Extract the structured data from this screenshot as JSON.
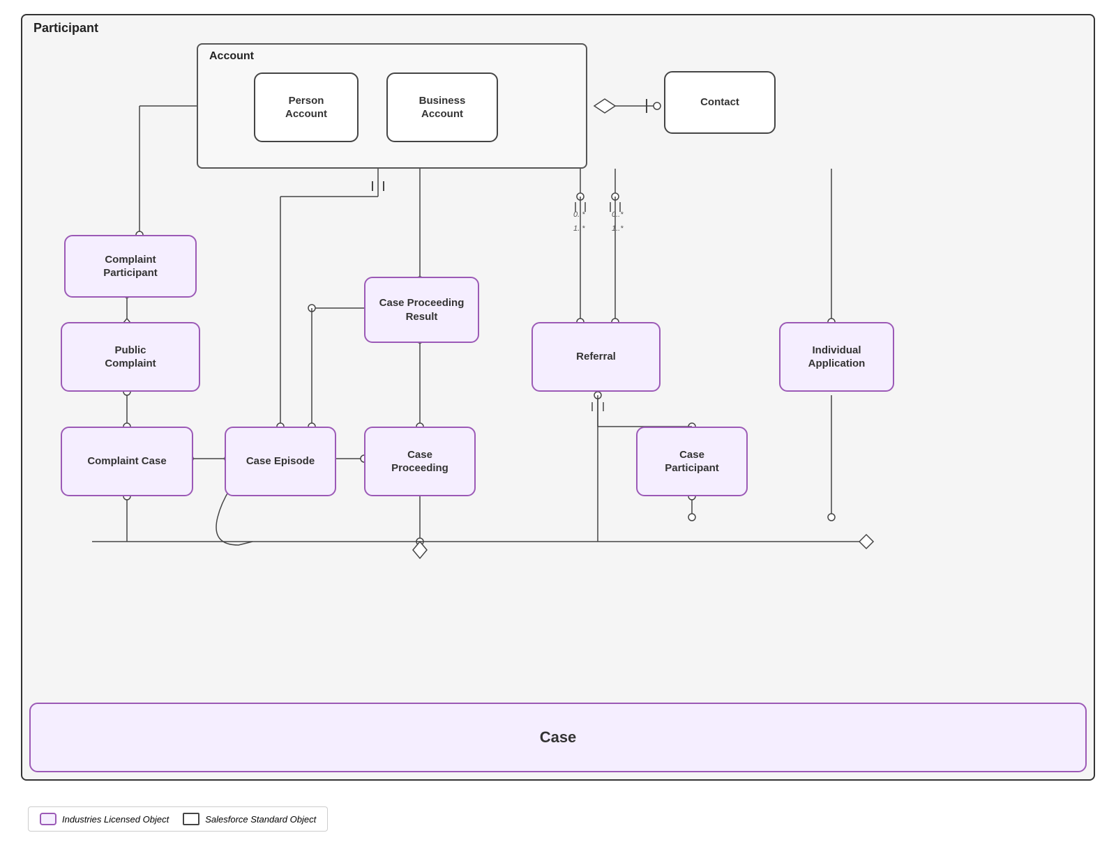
{
  "diagram": {
    "title": "Participant",
    "account_group": {
      "label": "Account",
      "entities": [
        {
          "id": "person-account",
          "label": "Person\nAccount",
          "type": "standard"
        },
        {
          "id": "business-account",
          "label": "Business\nAccount",
          "type": "standard"
        }
      ]
    },
    "nodes": [
      {
        "id": "contact",
        "label": "Contact",
        "type": "standard"
      },
      {
        "id": "complaint-participant",
        "label": "Complaint\nParticipant",
        "type": "industry"
      },
      {
        "id": "public-complaint",
        "label": "Public\nComplaint",
        "type": "industry"
      },
      {
        "id": "complaint-case",
        "label": "Complaint Case",
        "type": "industry"
      },
      {
        "id": "case-episode",
        "label": "Case Episode",
        "type": "industry"
      },
      {
        "id": "case-proceeding",
        "label": "Case\nProceeding",
        "type": "industry"
      },
      {
        "id": "case-proceeding-result",
        "label": "Case Proceeding\nResult",
        "type": "industry"
      },
      {
        "id": "referral",
        "label": "Referral",
        "type": "industry"
      },
      {
        "id": "case-participant",
        "label": "Case\nParticipant",
        "type": "industry"
      },
      {
        "id": "individual-application",
        "label": "Individual\nApplication",
        "type": "industry"
      },
      {
        "id": "case",
        "label": "Case",
        "type": "industry"
      }
    ],
    "legend": {
      "industry_label": "Industries Licensed Object",
      "standard_label": "Salesforce Standard Object"
    }
  }
}
